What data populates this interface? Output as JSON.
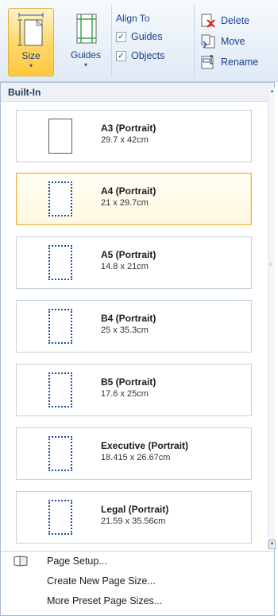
{
  "ribbon": {
    "size_label": "Size",
    "guides_label": "Guides",
    "align_to_label": "Align To",
    "checkbox_guides_label": "Guides",
    "checkbox_objects_label": "Objects",
    "delete_label": "Delete",
    "move_label": "Move",
    "rename_label": "Rename"
  },
  "panel": {
    "header": "Built-In",
    "items": [
      {
        "name": "A3 (Portrait)",
        "dims": "29.7 x 42cm"
      },
      {
        "name": "A4 (Portrait)",
        "dims": "21 x 29.7cm"
      },
      {
        "name": "A5 (Portrait)",
        "dims": "14.8 x 21cm"
      },
      {
        "name": "B4 (Portrait)",
        "dims": "25 x 35.3cm"
      },
      {
        "name": "B5 (Portrait)",
        "dims": "17.6 x 25cm"
      },
      {
        "name": "Executive (Portrait)",
        "dims": "18.415 x 26.67cm"
      },
      {
        "name": "Legal (Portrait)",
        "dims": "21.59 x 35.56cm"
      }
    ],
    "selected_index": 1
  },
  "menu": {
    "page_setup": "Page Setup...",
    "create_new": "Create New Page Size...",
    "more_presets": "More Preset Page Sizes..."
  },
  "icons": {
    "size": "page-size-icon",
    "guides": "guides-icon",
    "delete": "delete-page-icon",
    "move": "move-page-icon",
    "rename": "rename-page-icon",
    "page_setup": "page-setup-icon"
  },
  "colors": {
    "selected_border": "#f0b54f",
    "ribbon_text": "#15428b"
  }
}
